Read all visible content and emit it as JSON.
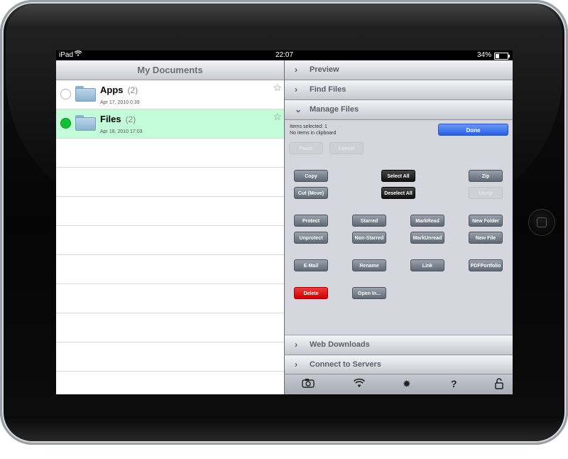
{
  "status_bar": {
    "device": "iPad",
    "time": "22:07",
    "battery": "34%"
  },
  "left_pane": {
    "title": "My Documents",
    "items": [
      {
        "name": "Apps",
        "count": "(2)",
        "date": "Apr 17, 2010 0:39",
        "selected": false
      },
      {
        "name": "Files",
        "count": "(2)",
        "date": "Apr 18, 2010 17:03",
        "selected": true
      }
    ]
  },
  "right_pane": {
    "sections_top": [
      {
        "label": "Preview",
        "expanded": false
      },
      {
        "label": "Find Files",
        "expanded": false
      },
      {
        "label": "Manage Files",
        "expanded": true
      }
    ],
    "manage": {
      "items_selected": "Items selected: 1",
      "clipboard": "No items in clipboard",
      "done": "Done",
      "paste": "Paste",
      "cancel": "Cancel",
      "copy": "Copy",
      "select_all": "Select All",
      "zip": "Zip",
      "cut_move": "Cut (Move)",
      "deselect_all": "Deselect All",
      "unzip": "Unzip",
      "protect": "Protect",
      "starred": "Starred",
      "markread": "MarkRead",
      "new_folder": "New Folder",
      "unprotect": "Unprotect",
      "non_starred": "Non-Starred",
      "markunread": "MarkUnread",
      "new_file": "New File",
      "email": "E-Mail",
      "rename": "Rename",
      "link": "Link",
      "pdfportfolio": "PDFPortfolio",
      "delete": "Delete",
      "open_in": "Open In..."
    },
    "sections_bottom": [
      {
        "label": "Web Downloads",
        "expanded": false
      },
      {
        "label": "Connect to Servers",
        "expanded": false
      }
    ],
    "toolbar": {
      "camera": "camera-icon",
      "wifi": "wifi-icon",
      "settings": "gear-icon",
      "help": "?",
      "lock": "lock-icon"
    }
  }
}
